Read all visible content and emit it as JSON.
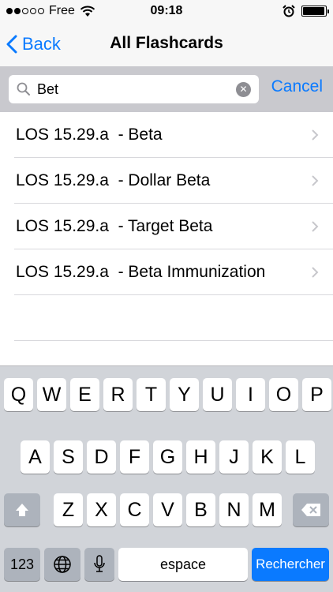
{
  "status_bar": {
    "carrier": "Free",
    "time": "09:18",
    "signal_bars": 2,
    "signal_total": 5,
    "battery_level": 0.95
  },
  "nav": {
    "back_label": "Back",
    "title": "All Flashcards"
  },
  "search": {
    "value": "Bet",
    "placeholder": "",
    "cancel_label": "Cancel"
  },
  "results": [
    {
      "label": "LOS 15.29.a  - Beta"
    },
    {
      "label": "LOS 15.29.a  - Dollar Beta"
    },
    {
      "label": "LOS 15.29.a  - Target Beta"
    },
    {
      "label": "LOS 15.29.a  - Beta Immunization"
    }
  ],
  "keyboard": {
    "row1": [
      "Q",
      "W",
      "E",
      "R",
      "T",
      "Y",
      "U",
      "I",
      "O",
      "P"
    ],
    "row2": [
      "A",
      "S",
      "D",
      "F",
      "G",
      "H",
      "J",
      "K",
      "L"
    ],
    "row3": [
      "Z",
      "X",
      "C",
      "V",
      "B",
      "N",
      "M"
    ],
    "numbers_label": "123",
    "space_label": "espace",
    "search_label": "Rechercher"
  },
  "colors": {
    "accent": "#0a7aff",
    "search_bar_bg": "#c9c9ce",
    "keyboard_bg": "#d1d4d9",
    "special_key_bg": "#adb3bc"
  }
}
